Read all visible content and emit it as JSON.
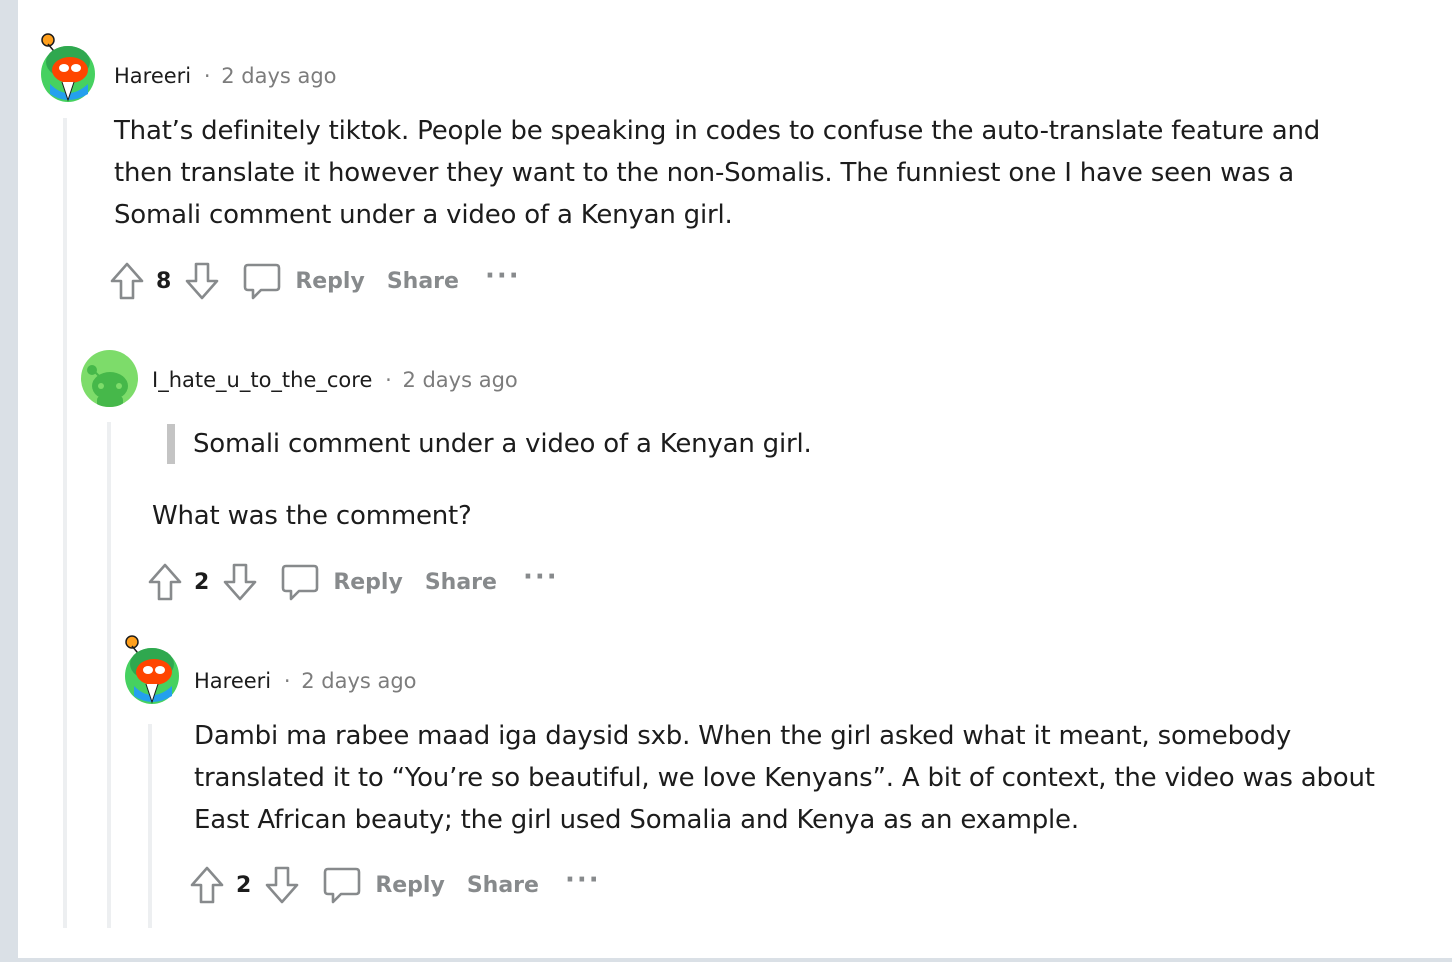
{
  "comments": [
    {
      "username": "Hareeri",
      "separator": "·",
      "time": "2 days ago",
      "body": "That’s definitely tiktok. People be speaking in codes to confuse the auto-translate feature and then translate it however they want to the non-Somalis. The funniest one I have seen was a Somali comment under a video of a Kenyan girl.",
      "score": "8",
      "reply_label": "Reply",
      "share_label": "Share",
      "more_label": "···"
    },
    {
      "username": "I_hate_u_to_the_core",
      "separator": "·",
      "time": "2 days ago",
      "quote": "Somali comment under a video of a Kenyan girl.",
      "body": "What was the comment?",
      "score": "2",
      "reply_label": "Reply",
      "share_label": "Share",
      "more_label": "···"
    },
    {
      "username": "Hareeri",
      "separator": "·",
      "time": "2 days ago",
      "body": "Dambi ma rabee maad iga daysid sxb. When the girl asked what it meant, somebody translated it to “You’re so beautiful, we love Kenyans”. A bit of context, the video was about East African beauty; the girl used Somalia and Kenya as an example.",
      "score": "2",
      "reply_label": "Reply",
      "share_label": "Share",
      "more_label": "···"
    }
  ],
  "icons": {
    "upvote": "arrow-up-icon",
    "downvote": "arrow-down-icon",
    "reply": "comment-bubble-icon",
    "avatar_1": "snoo-avatar-icon",
    "avatar_2": "snoo-green-avatar-icon"
  },
  "colors": {
    "background": "#dae0e6",
    "card": "#ffffff",
    "thread_line": "#edeff1",
    "muted_text": "#878a8c",
    "avatar_green": "#7ddc6a"
  }
}
